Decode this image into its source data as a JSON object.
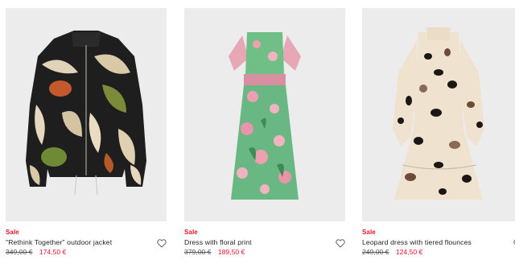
{
  "products": [
    {
      "badge": "Sale",
      "name": "\"Rethink Together\" outdoor jacket",
      "old_price": "349,00 €",
      "new_price": "174,50 €"
    },
    {
      "badge": "Sale",
      "name": "Dress with floral print",
      "old_price": "379,00 €",
      "new_price": "189,50 €"
    },
    {
      "badge": "Sale",
      "name": "Leopard dress with tiered flounces",
      "old_price": "249,00 €",
      "new_price": "124,50 €"
    }
  ],
  "colors": {
    "sale": "#e5152c",
    "image_bg": "#ececec",
    "text": "#222222"
  },
  "icons": {
    "wishlist": "heart-outline-icon"
  }
}
